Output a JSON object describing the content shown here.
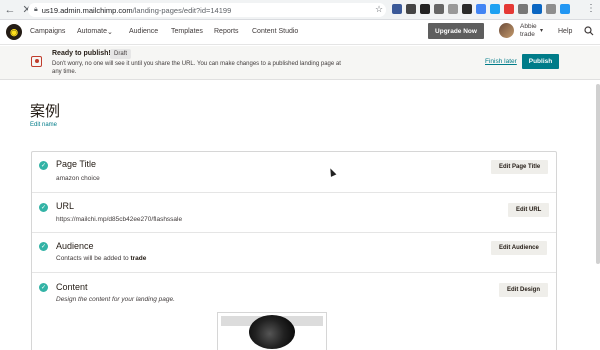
{
  "browser": {
    "url_host": "us19.admin.mailchimp.com",
    "url_path": "/landing-pages/edit?id=14199"
  },
  "nav": {
    "items": [
      "Campaigns",
      "Automate",
      "Audience",
      "Templates",
      "Reports",
      "Content Studio"
    ],
    "upgrade_label": "Upgrade Now",
    "user_line1": "Abbie",
    "user_line2": "trade",
    "help_label": "Help"
  },
  "banner": {
    "title": "Ready to publish!",
    "badge": "Draft",
    "description": "Don't worry, no one will see it until you share the URL. You can make changes to a published landing page at any time.",
    "finish_later": "Finish later",
    "publish": "Publish"
  },
  "page": {
    "title": "案例",
    "edit_name": "Edit name"
  },
  "sections": [
    {
      "title": "Page Title",
      "value": "amazon choice",
      "button": "Edit Page Title"
    },
    {
      "title": "URL",
      "value": "https://mailchi.mp/d85cb42ee270/flashssale",
      "button": "Edit URL"
    },
    {
      "title": "Audience",
      "value_prefix": "Contacts will be added to ",
      "value_bold": "trade",
      "button": "Edit Audience"
    },
    {
      "title": "Content",
      "value": "Design the content for your landing page.",
      "button": "Edit Design"
    }
  ],
  "colors": {
    "accent": "#007c89",
    "check": "#33b3a6",
    "upgrade": "#5e5e5e"
  }
}
